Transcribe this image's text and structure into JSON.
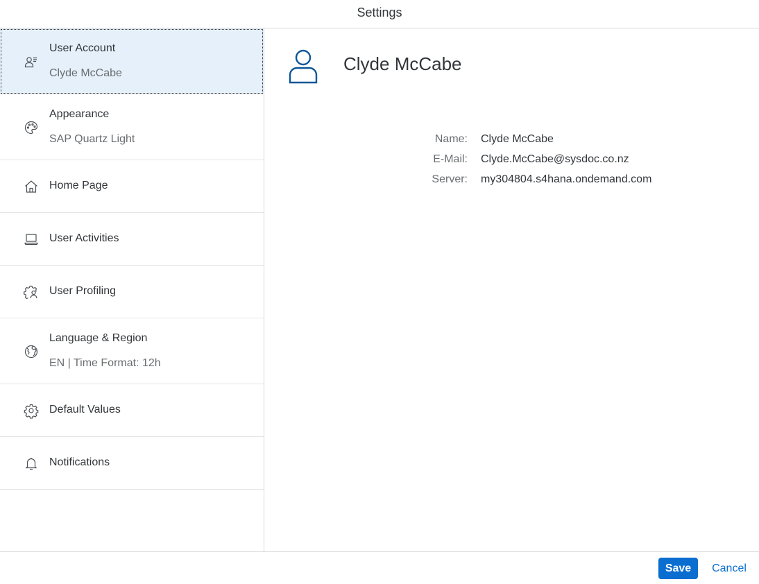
{
  "dialog": {
    "title": "Settings"
  },
  "sidebar": {
    "items": [
      {
        "label": "User Account",
        "sub": "Clyde McCabe",
        "icon": "user-account-icon",
        "selected": true
      },
      {
        "label": "Appearance",
        "sub": "SAP Quartz Light",
        "icon": "palette-icon"
      },
      {
        "label": "Home Page",
        "icon": "home-icon"
      },
      {
        "label": "User Activities",
        "icon": "laptop-icon"
      },
      {
        "label": "User Profiling",
        "icon": "user-settings-icon"
      },
      {
        "label": "Language & Region",
        "sub": "EN | Time Format: 12h",
        "icon": "globe-icon"
      },
      {
        "label": "Default Values",
        "icon": "gear-icon"
      },
      {
        "label": "Notifications",
        "icon": "bell-icon"
      }
    ]
  },
  "account": {
    "display_name": "Clyde McCabe",
    "fields": [
      {
        "key": "Name:",
        "value": "Clyde McCabe"
      },
      {
        "key": "E-Mail:",
        "value": "Clyde.McCabe@sysdoc.co.nz"
      },
      {
        "key": "Server:",
        "value": "my304804.s4hana.ondemand.com"
      }
    ]
  },
  "footer": {
    "save_label": "Save",
    "cancel_label": "Cancel"
  },
  "colors": {
    "accent": "#0a6ed1",
    "selected_bg": "#e5f0fa",
    "avatar": "#0a5699"
  }
}
